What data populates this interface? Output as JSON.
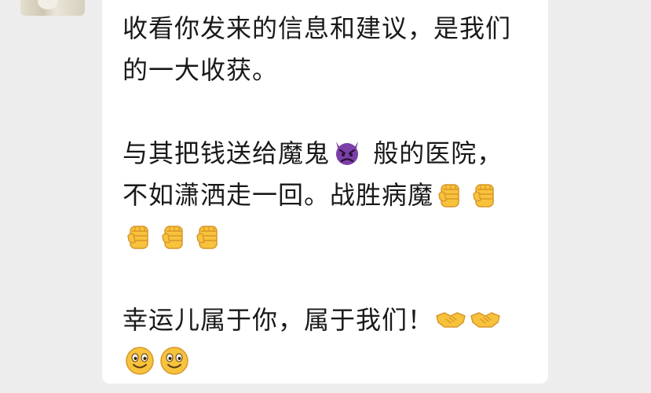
{
  "message": {
    "p1_l1": "收看你发来的信息和建议，是我们",
    "p1_l2": "的一大收获。",
    "p2_l1_a": "与其把钱送给魔鬼",
    "p2_l1_b": " 般的医院，",
    "p2_l2": "不如潇洒走一回。战胜病魔",
    "p3_l1": "幸运儿属于你，属于我们！"
  },
  "icons": {
    "devil": "angry-devil-emoji",
    "fist": "raised-fist-emoji",
    "handshake": "handshake-emoji",
    "smile": "smiley-emoji"
  },
  "colors": {
    "background": "#ededed",
    "bubble": "#ffffff",
    "text": "#191919",
    "emoji_yellow": "#f7c33c",
    "devil_purple": "#7b3fa6"
  }
}
